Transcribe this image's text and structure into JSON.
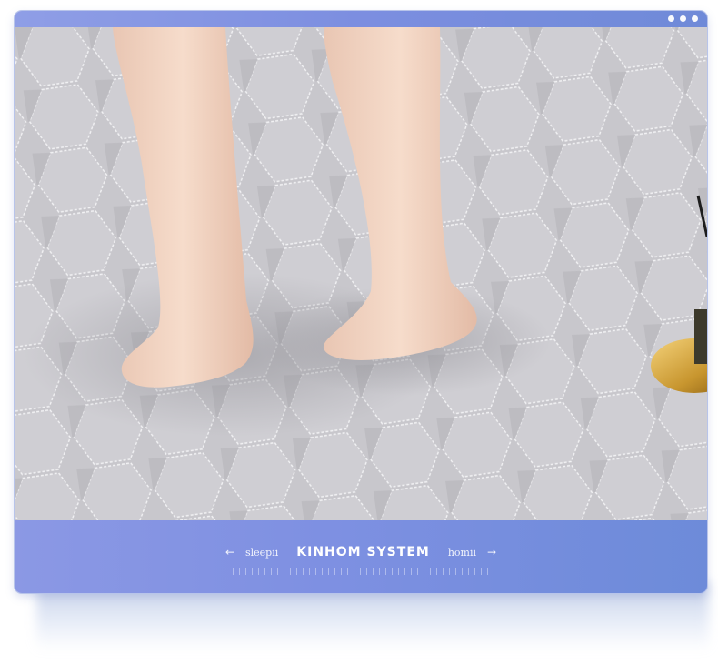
{
  "banner": {
    "left_text": "sleepii",
    "title": "KINHOM SYSTEM",
    "right_text": "homii",
    "left_arrow": "←",
    "right_arrow": "→"
  },
  "colors": {
    "accent": "#7c8ee0",
    "mattress": "#c9c8cd"
  },
  "icons": [
    "window-dot-icon",
    "arrow-left-icon",
    "arrow-right-icon"
  ]
}
